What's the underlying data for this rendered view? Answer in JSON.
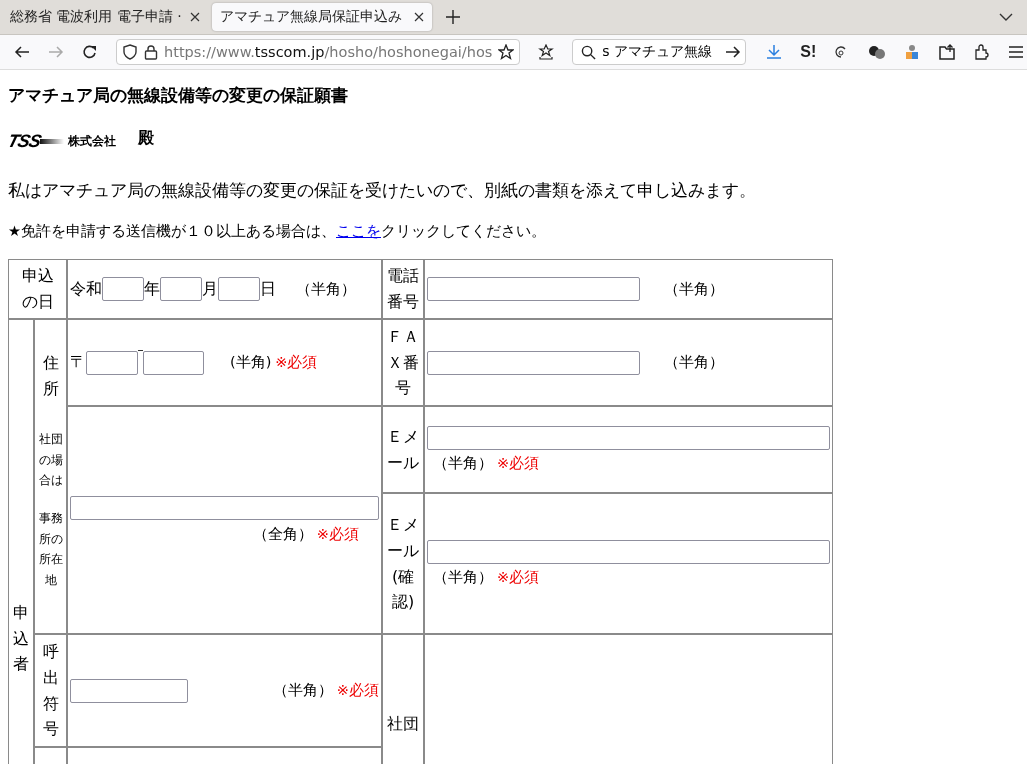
{
  "browser": {
    "tabs": [
      {
        "title": "総務省 電波利用 電子申請 ·",
        "selected": false
      },
      {
        "title": "アマチュア無線局保証申込み",
        "selected": true
      }
    ],
    "url": {
      "scheme": "https://www.",
      "host": "tsscom.jp",
      "path": "/hosho/hoshonegai/hos"
    },
    "search_value": "s アマチュア無線",
    "extension_label": "S!"
  },
  "page": {
    "title": "アマチュア局の無線設備等の変更の保証願書",
    "logo_text": "TSS",
    "company": "株式会社",
    "honorific": "殿",
    "intro": "私はアマチュア局の無線設備等の変更の保証を受けたいので、別紙の書類を添えて申し込みます。",
    "notice": {
      "before": "★免許を申請する送信機が１０以上ある場合は、",
      "link": "ここを",
      "after": "クリックしてください。"
    }
  },
  "form": {
    "date": {
      "label": "申込の日",
      "era": "令和",
      "units": [
        "年",
        "月",
        "日"
      ],
      "hint": "（半角）"
    },
    "phone": {
      "label": "電話番号",
      "hint": "（半角）"
    },
    "applicant_label": "申込者",
    "address": {
      "label": "住所",
      "notes": [
        "社団の場合は",
        "事務所の所在地"
      ],
      "postal_mark": "〒",
      "postal_hint": "(半角)",
      "postal_required": "※必須",
      "hint": "（全角）",
      "required": "※必須"
    },
    "fax": {
      "label": "ＦＡＸ番号",
      "hint": "（半角）"
    },
    "email": {
      "label": "Ｅメール",
      "hint": "（半角）",
      "required": "※必須"
    },
    "email_confirm": {
      "label": "Ｅメール(確認)",
      "hint": "（半角）",
      "required": "※必須"
    },
    "callsign": {
      "label": "呼出符号",
      "hint": "（半角）",
      "required": "※必須"
    },
    "club_name": {
      "label": "社団"
    }
  }
}
